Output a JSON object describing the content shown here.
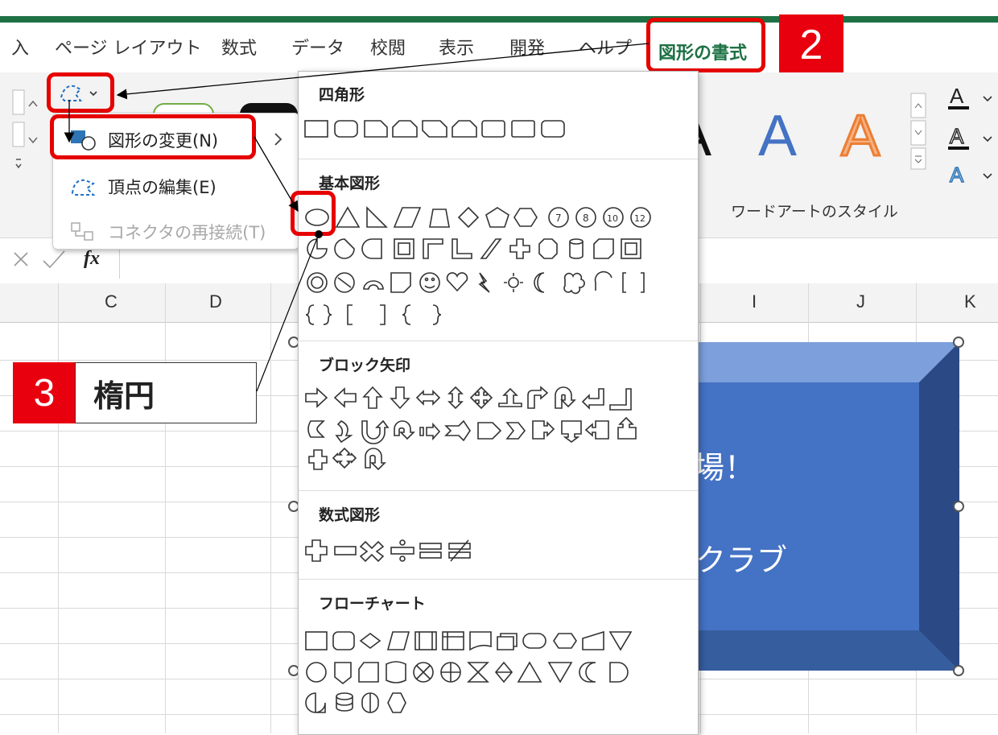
{
  "tabs": [
    {
      "label": "入"
    },
    {
      "label": "ページ レイアウト"
    },
    {
      "label": "数式"
    },
    {
      "label": "データ"
    },
    {
      "label": "校閲"
    },
    {
      "label": "表示"
    },
    {
      "label": "開発"
    },
    {
      "label": "ヘルプ"
    },
    {
      "label": "図形の書式"
    }
  ],
  "step_labels": {
    "step2": "2",
    "step3": "3"
  },
  "callout_text": "楕円",
  "context_menu": {
    "items": [
      {
        "label": "図形の変更(N)",
        "icon": "change-shape-icon"
      },
      {
        "label": "頂点の編集(E)",
        "icon": "edit-points-icon"
      },
      {
        "label": "コネクタの再接続(T)",
        "icon": "reroute-connector-icon",
        "disabled": true
      }
    ]
  },
  "gallery": {
    "sections": [
      {
        "title": "四角形"
      },
      {
        "title": "基本図形"
      },
      {
        "title": "ブロック矢印"
      },
      {
        "title": "数式図形"
      },
      {
        "title": "フローチャート"
      }
    ]
  },
  "ribbon": {
    "wordart_group_label": "ワードアートのスタイル",
    "wordart_letter": "A",
    "fx_label": "fx"
  },
  "columns": [
    "C",
    "D",
    "I",
    "J",
    "K"
  ],
  "shape_text": {
    "line1": "場！",
    "line2": "クラブ"
  },
  "colors": {
    "accent_green": "#1e7145",
    "highlight_red": "#e60000",
    "shape_blue": "#4472c4",
    "wordart_orange": "#ed7d31"
  }
}
